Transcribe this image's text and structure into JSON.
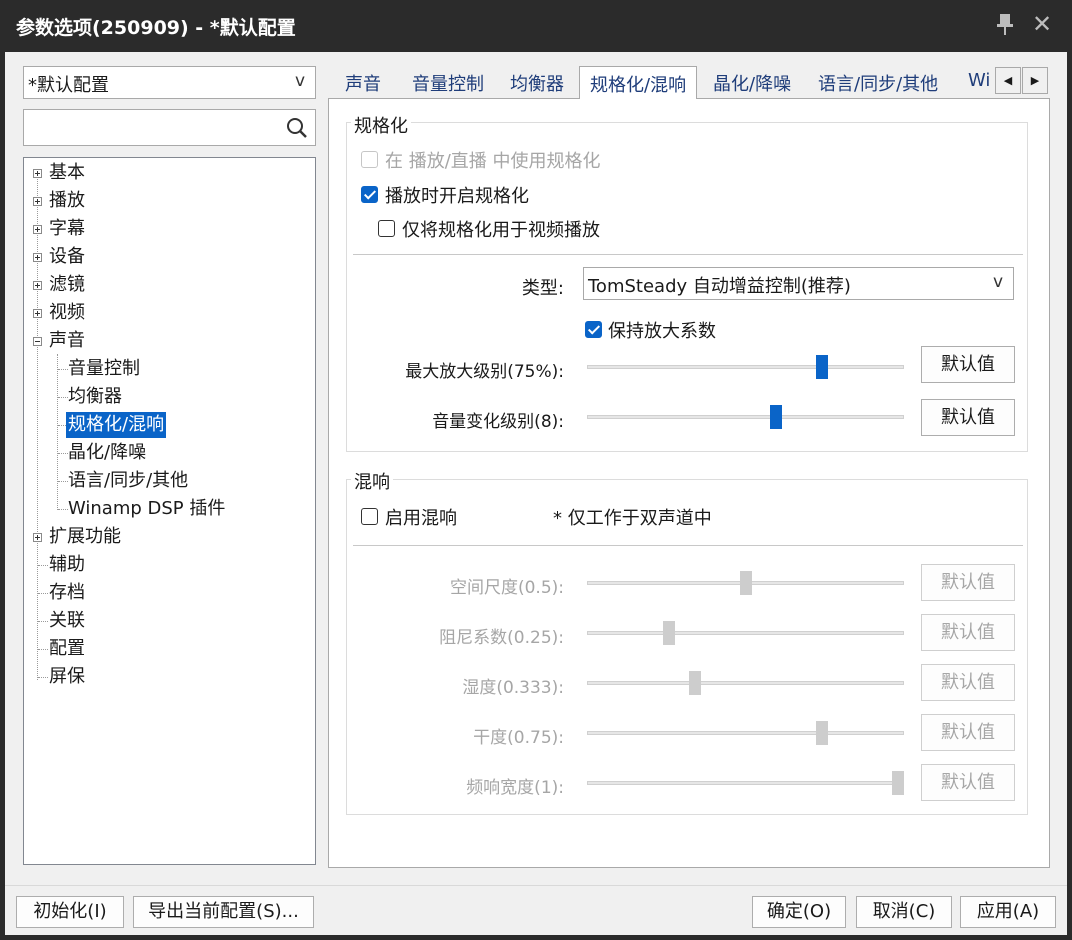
{
  "window": {
    "title": "参数选项(250909) - *默认配置",
    "close_glyph": "✕"
  },
  "profile_combo": {
    "value": "*默认配置",
    "arrow": "v"
  },
  "search": {
    "placeholder": ""
  },
  "tree": {
    "items": [
      {
        "label": "基本",
        "expander": "plus"
      },
      {
        "label": "播放",
        "expander": "plus"
      },
      {
        "label": "字幕",
        "expander": "plus"
      },
      {
        "label": "设备",
        "expander": "plus"
      },
      {
        "label": "滤镜",
        "expander": "plus"
      },
      {
        "label": "视频",
        "expander": "plus"
      },
      {
        "label": "声音",
        "expander": "minus"
      },
      {
        "label": "扩展功能",
        "expander": "plus"
      },
      {
        "label": "辅助",
        "expander": "none"
      },
      {
        "label": "存档",
        "expander": "none"
      },
      {
        "label": "关联",
        "expander": "none"
      },
      {
        "label": "配置",
        "expander": "none"
      },
      {
        "label": "屏保",
        "expander": "none"
      }
    ],
    "sound_children": [
      "音量控制",
      "均衡器",
      "规格化/混响",
      "晶化/降噪",
      "语言/同步/其他",
      "Winamp DSP 插件"
    ],
    "selected": "规格化/混响"
  },
  "tabs": {
    "items": [
      "声音",
      "音量控制",
      "均衡器",
      "规格化/混响",
      "晶化/降噪",
      "语言/同步/其他",
      "Wi"
    ],
    "active": "规格化/混响",
    "prev_glyph": "◀",
    "next_glyph": "▶"
  },
  "normalize": {
    "title": "规格化",
    "use_in_play": {
      "label": "在 播放/直播 中使用规格化",
      "checked": false,
      "enabled": false
    },
    "on_play": {
      "label": "播放时开启规格化",
      "checked": true
    },
    "video_only": {
      "label": "仅将规格化用于视频播放",
      "checked": false
    },
    "type_label": "类型:",
    "type_value": "TomSteady 自动增益控制(推荐)",
    "type_arrow": "v",
    "keep_gain": {
      "label": "保持放大系数",
      "checked": true
    },
    "sliders": [
      {
        "label": "最大放大级别(75%):",
        "value": 0.75,
        "button": "默认值"
      },
      {
        "label": "音量变化级别(8):",
        "value": 0.6,
        "button": "默认值"
      }
    ]
  },
  "reverb": {
    "title": "混响",
    "enable": {
      "label": "启用混响",
      "checked": false
    },
    "note": "* 仅工作于双声道中",
    "sliders": [
      {
        "label": "空间尺度(0.5):",
        "value": 0.5,
        "button": "默认值"
      },
      {
        "label": "阻尼系数(0.25):",
        "value": 0.25,
        "button": "默认值"
      },
      {
        "label": "湿度(0.333):",
        "value": 0.333,
        "button": "默认值"
      },
      {
        "label": "干度(0.75):",
        "value": 0.75,
        "button": "默认值"
      },
      {
        "label": "频响宽度(1):",
        "value": 1.0,
        "button": "默认值"
      }
    ]
  },
  "footer": {
    "init_button": "初始化(I)",
    "export_button": "导出当前配置(S)...",
    "ok_button": "确定(O)",
    "cancel_button": "取消(C)",
    "apply_button": "应用(A)"
  },
  "colors": {
    "accent": "#0a64c8",
    "titlebar": "#2b2b2b",
    "disabled_text": "#a6a6a6"
  }
}
